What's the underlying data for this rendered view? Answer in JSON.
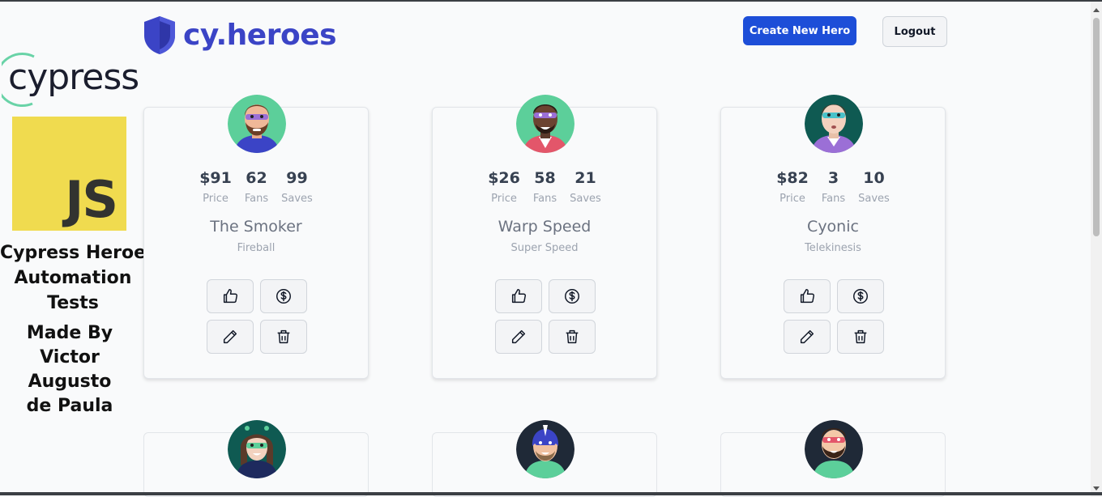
{
  "overlay": {
    "cypress_logo_text": "cypress",
    "js_logo_text": "JS",
    "title_lines": [
      "Cypress Heroes",
      "Automation",
      "Tests"
    ],
    "author_lines": [
      "Made By",
      "Victor",
      "Augusto",
      "de Paula"
    ]
  },
  "header": {
    "brand": "cy.heroes",
    "create_label": "Create New Hero",
    "logout_label": "Logout"
  },
  "colors": {
    "brand": "#3b44c6",
    "primary_button": "#1d4ed8"
  },
  "heroes": [
    {
      "name": "The Smoker",
      "power": "Fireball",
      "price": "$91",
      "fans": "62",
      "saves": "99",
      "price_label": "Price",
      "fans_label": "Fans",
      "saves_label": "Saves"
    },
    {
      "name": "Warp Speed",
      "power": "Super Speed",
      "price": "$26",
      "fans": "58",
      "saves": "21",
      "price_label": "Price",
      "fans_label": "Fans",
      "saves_label": "Saves"
    },
    {
      "name": "Cyonic",
      "power": "Telekinesis",
      "price": "$82",
      "fans": "3",
      "saves": "10",
      "price_label": "Price",
      "fans_label": "Fans",
      "saves_label": "Saves"
    }
  ],
  "icons": [
    "thumbs-up-icon",
    "dollar-icon",
    "pencil-icon",
    "trash-icon"
  ]
}
